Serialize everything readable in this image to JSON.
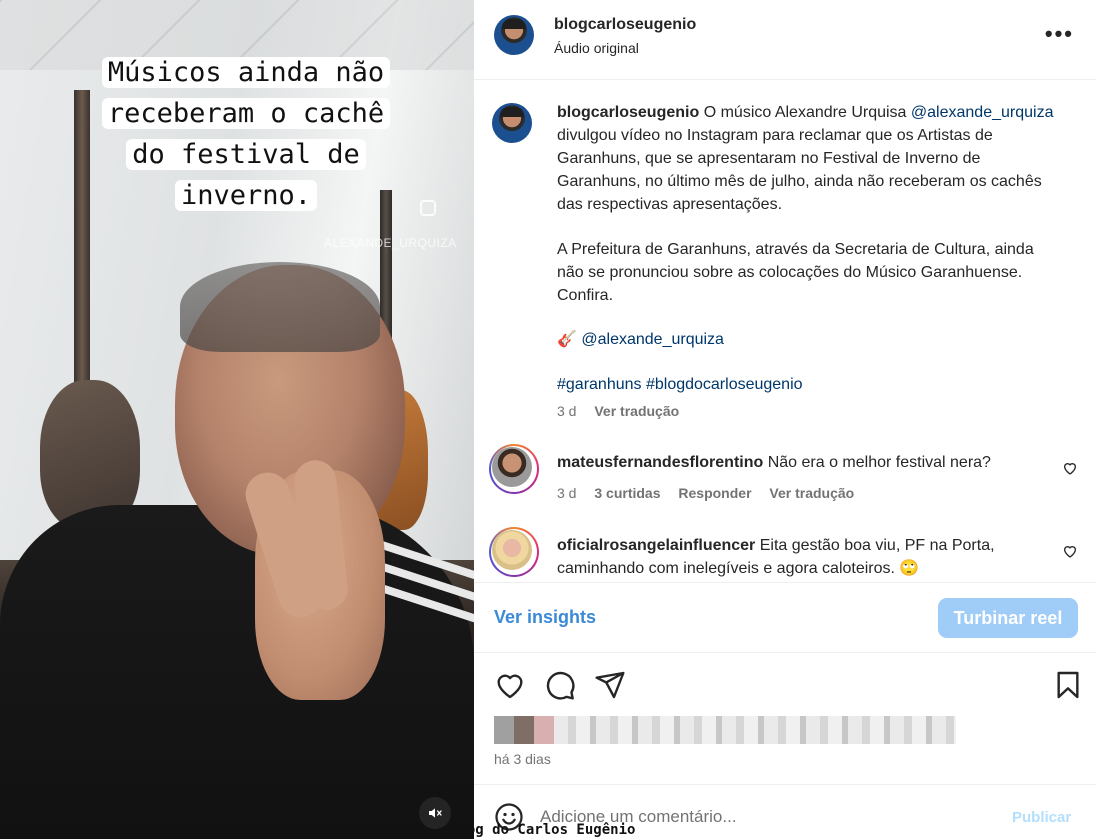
{
  "video": {
    "caption_lines": [
      "Músicos ainda não",
      "receberam o cachê",
      "do festival de",
      "inverno."
    ],
    "watermark": "ALEXANDE_URQUIZA",
    "mute_icon": "speaker-muted-icon"
  },
  "header": {
    "username": "blogcarloseugenio",
    "audio": "Áudio original",
    "more_icon": "•••"
  },
  "post": {
    "username": "blogcarloseugenio",
    "text_1": " O músico Alexandre Urquisa ",
    "mention_1": "@alexande_urquiza",
    "text_2": " divulgou vídeo no Instagram para reclamar que os Artistas de Garanhuns, que se apresentaram no Festival de Inverno de Garanhuns, no último mês de julho, ainda não receberam os cachês das respectivas apresentações.",
    "paragraph_2": "A Prefeitura de Garanhuns, através da Secretaria de Cultura, ainda não se pronunciou sobre as colocações do Músico Garanhuense. Confira.",
    "emoji_mention_icon": "🎸",
    "mention_2": "@alexande_urquiza",
    "hashtags": "#garanhuns #blogdocarloseugenio",
    "age": "3 d",
    "translate": "Ver tradução"
  },
  "comments": [
    {
      "username": "mateusfernandesflorentino",
      "text": " Não era o melhor festival nera?",
      "age": "3 d",
      "likes": "3 curtidas",
      "reply": "Responder",
      "translate": "Ver tradução"
    },
    {
      "username": "oficialrosangelainfluencer",
      "text": " Eita gestão boa viu, PF na Porta, caminhando com inelegíveis e agora caloteiros. 🙄"
    }
  ],
  "insights": {
    "link": "Ver insights",
    "boost": "Turbinar reel"
  },
  "footer": {
    "time_ago": "há 3 dias",
    "comment_placeholder": "Adicione um comentário...",
    "publish": "Publicar",
    "brand": "Blog do Carlos Eugênio"
  },
  "colors": {
    "link": "#00376b",
    "accent_blue": "#3a8ad6",
    "boost_bg": "#9fcdf7"
  }
}
